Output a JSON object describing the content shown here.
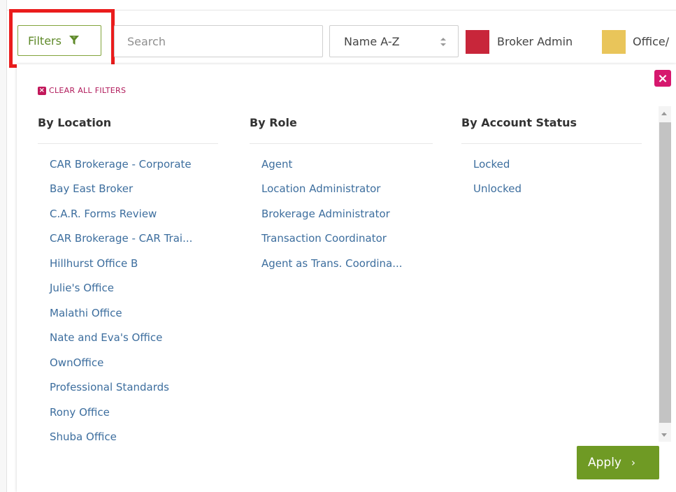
{
  "toolbar": {
    "filters_label": "Filters",
    "search_placeholder": "Search",
    "sort_value": "Name A-Z"
  },
  "legend": [
    {
      "label": "Broker Admin",
      "color": "#c8263a"
    },
    {
      "label": "Office/",
      "color": "#e9c55a"
    }
  ],
  "panel": {
    "clear_all": "CLEAR ALL FILTERS",
    "apply_label": "Apply",
    "columns": {
      "location": {
        "heading": "By Location",
        "items": [
          "CAR Brokerage - Corporate",
          "Bay East Broker",
          "C.A.R. Forms Review",
          "CAR Brokerage - CAR Trai...",
          "Hillhurst Office B",
          "Julie's Office",
          "Malathi Office",
          "Nate and Eva's Office",
          "OwnOffice",
          "Professional Standards",
          "Rony Office",
          "Shuba Office"
        ]
      },
      "role": {
        "heading": "By Role",
        "items": [
          "Agent",
          "Location Administrator",
          "Brokerage Administrator",
          "Transaction Coordinator",
          "Agent as Trans. Coordina..."
        ]
      },
      "status": {
        "heading": "By Account Status",
        "items": [
          "Locked",
          "Unlocked"
        ]
      }
    }
  },
  "colors": {
    "accent_green": "#6f9a24",
    "link_blue": "#3d6e9e",
    "close_pink": "#d6186e",
    "highlight_red": "#ea1c1c"
  }
}
